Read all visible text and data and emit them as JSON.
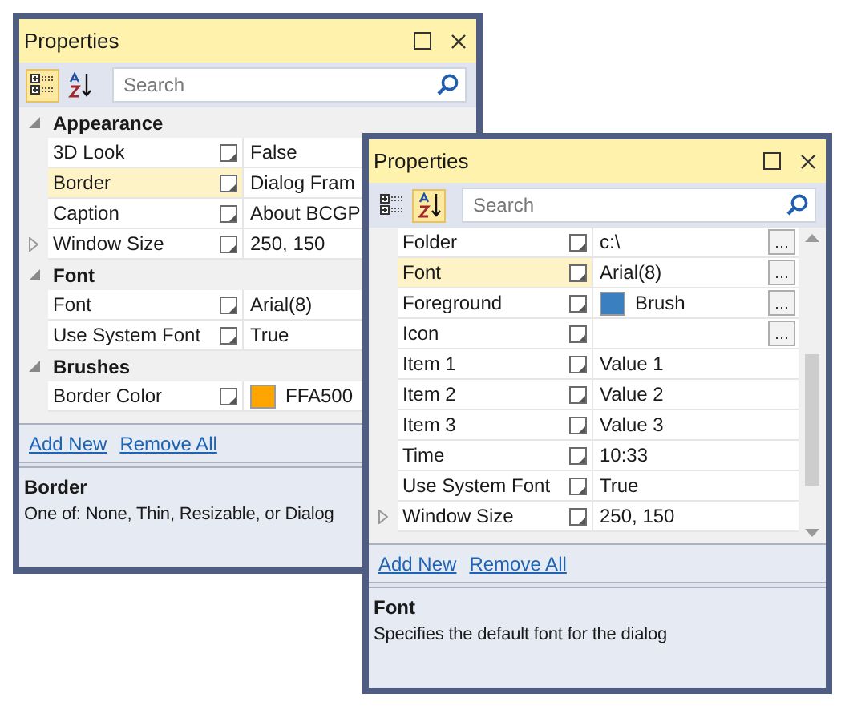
{
  "windows": [
    {
      "title": "Properties",
      "view_buttons": [
        {
          "kind": "categorized",
          "selected": true
        },
        {
          "kind": "alphabetical",
          "selected": false
        }
      ],
      "search": {
        "placeholder": "Search"
      },
      "rows": [
        {
          "kind": "group",
          "name": "Appearance",
          "expanded": true
        },
        {
          "kind": "item",
          "name": "3D Look",
          "value": "False",
          "selected": false
        },
        {
          "kind": "item",
          "name": "Border",
          "value": "Dialog Fram",
          "selected": true
        },
        {
          "kind": "item",
          "name": "Caption",
          "value": "About BCGP",
          "selected": false
        },
        {
          "kind": "item",
          "name": "Window Size",
          "value": "250, 150",
          "selected": false,
          "expanded": false
        },
        {
          "kind": "group",
          "name": "Font",
          "expanded": true
        },
        {
          "kind": "item",
          "name": "Font",
          "value": "Arial(8)",
          "selected": false
        },
        {
          "kind": "item",
          "name": "Use System Font",
          "value": "True",
          "selected": false
        },
        {
          "kind": "group",
          "name": "Brushes",
          "expanded": true
        },
        {
          "kind": "color",
          "name": "Border Color",
          "value": "FFA500",
          "color": "#ffa500",
          "selected": false
        }
      ],
      "links": [
        "Add New",
        "Remove All"
      ],
      "description": {
        "title": "Border",
        "text": "One of: None, Thin, Resizable, or Dialog"
      }
    },
    {
      "title": "Properties",
      "view_buttons": [
        {
          "kind": "categorized",
          "selected": false
        },
        {
          "kind": "alphabetical",
          "selected": true
        }
      ],
      "search": {
        "placeholder": "Search"
      },
      "rows": [
        {
          "kind": "item",
          "name": "Folder",
          "value": "c:\\",
          "selected": false,
          "ellipsis": true
        },
        {
          "kind": "item",
          "name": "Font",
          "value": "Arial(8)",
          "selected": true,
          "ellipsis": true
        },
        {
          "kind": "color",
          "name": "Foreground",
          "value": "Brush",
          "color": "#3a7fc0",
          "selected": false,
          "ellipsis": true
        },
        {
          "kind": "item",
          "name": "Icon",
          "selected": false,
          "ellipsis": true
        },
        {
          "kind": "item",
          "name": "Item 1",
          "value": "Value 1",
          "selected": false
        },
        {
          "kind": "item",
          "name": "Item 2",
          "value": "Value 2",
          "selected": false
        },
        {
          "kind": "item",
          "name": "Item 3",
          "value": "Value 3",
          "selected": false
        },
        {
          "kind": "item",
          "name": "Time",
          "value": "10:33",
          "selected": false
        },
        {
          "kind": "item",
          "name": "Use System Font",
          "value": "True",
          "selected": false
        },
        {
          "kind": "item",
          "name": "Window Size",
          "value": "250, 150",
          "selected": false,
          "expanded": false
        }
      ],
      "links": [
        "Add New",
        "Remove All"
      ],
      "description": {
        "title": "Font",
        "text": "Specifies the default font for the dialog"
      }
    }
  ]
}
